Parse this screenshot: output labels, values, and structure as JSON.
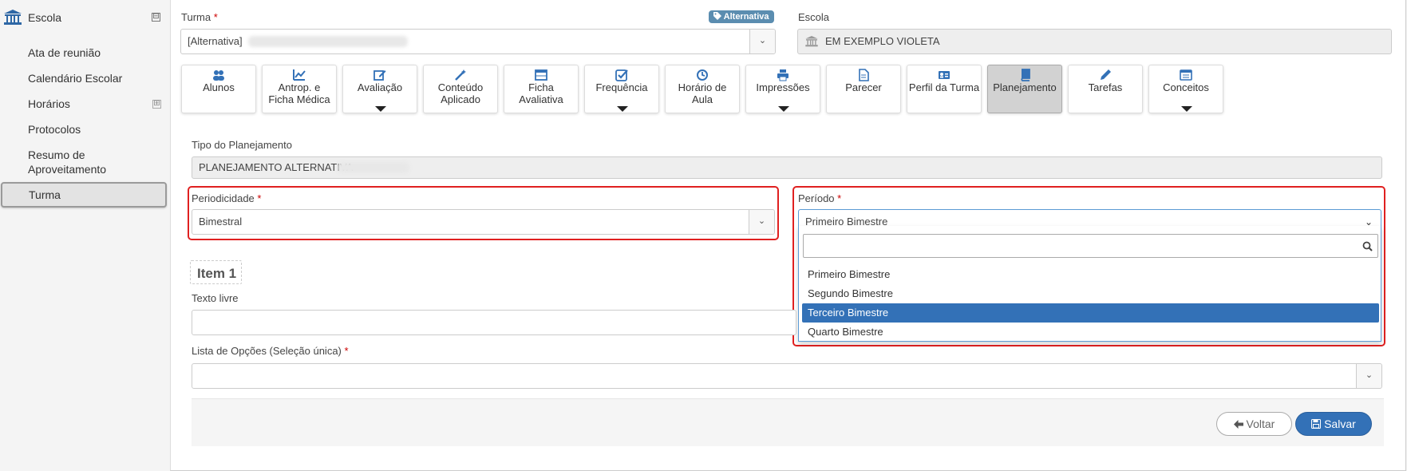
{
  "sidebar": {
    "title": "Escola",
    "collapse_symbol": "⊟",
    "items": [
      {
        "label": "Ata de reunião"
      },
      {
        "label": "Calendário Escolar"
      },
      {
        "label": "Horários"
      },
      {
        "label": "Protocolos"
      },
      {
        "label": "Resumo de"
      },
      {
        "label": "Aproveitamento"
      },
      {
        "label": "Turma"
      }
    ],
    "expand_symbol": "⊞"
  },
  "form": {
    "turma_label": "Turma",
    "required": "*",
    "badge": "Alternativa",
    "turma_value": "[Alternativa]",
    "escola_label": "Escola",
    "escola_value": "EM EXEMPLO VIOLETA",
    "chevron": "⌄"
  },
  "tabs": [
    {
      "label": "Alunos",
      "icon": "users-icon"
    },
    {
      "label": "Antrop. e",
      "label2": "Ficha Médica",
      "icon": "chart-line-icon"
    },
    {
      "label": "Avaliação",
      "icon": "edit-icon"
    },
    {
      "label": "Conteúdo",
      "label2": "Aplicado",
      "icon": "magic-wand-icon"
    },
    {
      "label": "Ficha",
      "label2": "Avaliativa",
      "icon": "table-icon"
    },
    {
      "label": "Frequência",
      "icon": "check-square-icon"
    },
    {
      "label": "Horário de",
      "label2": "Aula",
      "icon": "clock-icon"
    },
    {
      "label": "Impressões",
      "icon": "print-icon"
    },
    {
      "label": "Parecer",
      "icon": "file-icon"
    },
    {
      "label": "Perfil da Turma",
      "icon": "id-card-icon"
    },
    {
      "label": "Planejamento",
      "icon": "book-icon"
    },
    {
      "label": "Tarefas",
      "icon": "pencil-icon"
    },
    {
      "label": "Conceitos",
      "icon": "list-icon"
    }
  ],
  "planning": {
    "tipo_label": "Tipo do Planejamento",
    "tipo_value": "PLANEJAMENTO ALTERNATIVA",
    "periodicidade_label": "Periodicidade",
    "periodicidade_value": "Bimestral",
    "periodo_label": "Período",
    "periodo_value": "Primeiro Bimestre",
    "periodo_options": [
      "Primeiro Bimestre",
      "Segundo Bimestre",
      "Terceiro Bimestre",
      "Quarto Bimestre"
    ],
    "periodo_highlighted": "Terceiro Bimestre",
    "item_title": "Item 1",
    "texto_livre_label": "Texto livre",
    "texto_livre_value": "",
    "lista_label": "Lista de Opções (Seleção única)",
    "lista_value": ""
  },
  "actions": {
    "voltar": "Voltar",
    "salvar": "Salvar"
  },
  "colors": {
    "primary": "#3371b7",
    "highlight_border": "#e02020",
    "badge": "#5b8db0"
  }
}
